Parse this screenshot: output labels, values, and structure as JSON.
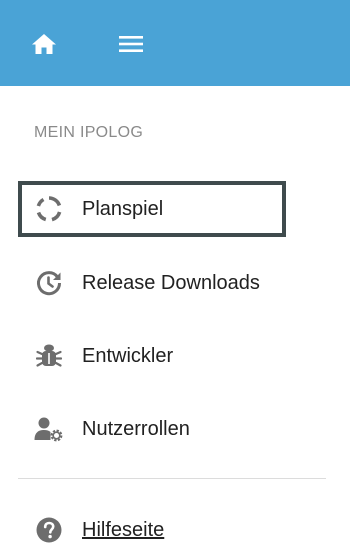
{
  "topbar": {
    "background_color": "#4aa3d6",
    "home_icon": "home-icon",
    "menu_icon": "hamburger-menu-icon"
  },
  "sidebar": {
    "section_title": "MEIN IPOLOG",
    "items": [
      {
        "label": "Planspiel",
        "icon": "circle-notch-icon",
        "focused": true
      },
      {
        "label": "Release Downloads",
        "icon": "history-clock-icon"
      },
      {
        "label": "Entwickler",
        "icon": "bug-icon"
      },
      {
        "label": "Nutzerrollen",
        "icon": "user-gear-icon"
      }
    ],
    "help": {
      "label": "Hilfeseite",
      "icon": "question-circle-icon"
    }
  }
}
